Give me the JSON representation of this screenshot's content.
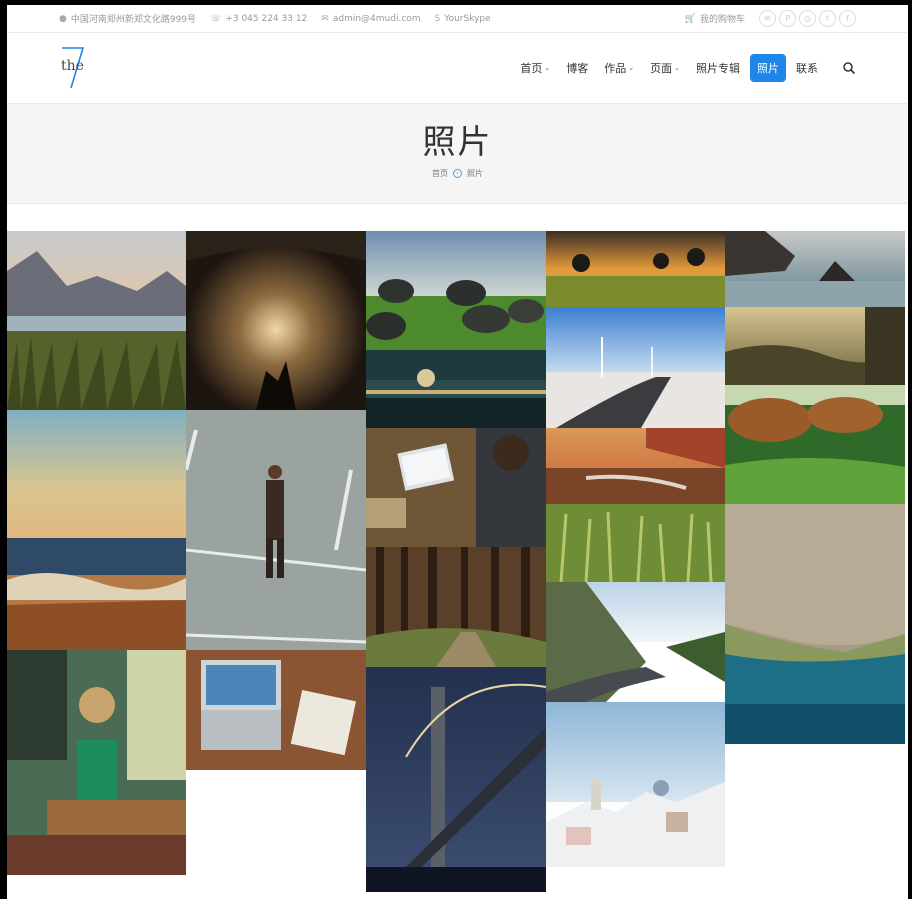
{
  "topbar": {
    "address": "中国河南郑州新郑文化路999号",
    "phone": "+3 045 224 33 12",
    "email": "admin@4mudi.com",
    "skype": "YourSkype",
    "cart": "我的购物车",
    "social_icons": [
      "mail-icon",
      "pinterest-icon",
      "dribbble-icon",
      "twitter-icon",
      "facebook-icon"
    ]
  },
  "logo": {
    "text": "the",
    "accent_color": "#1e86e8"
  },
  "nav": {
    "items": [
      {
        "label": "首页",
        "dropdown": true
      },
      {
        "label": "博客",
        "dropdown": false
      },
      {
        "label": "作品",
        "dropdown": true
      },
      {
        "label": "页面",
        "dropdown": true
      },
      {
        "label": "照片专辑",
        "dropdown": false
      },
      {
        "label": "照片",
        "dropdown": false,
        "active": true
      },
      {
        "label": "联系",
        "dropdown": false
      }
    ],
    "active_color": "#1e86e8"
  },
  "page": {
    "title": "照片",
    "breadcrumb": [
      "首页",
      "照片"
    ]
  },
  "gallery": {
    "photos": [
      "lake-mountains",
      "concert-stage",
      "rocks-field",
      "sunset-trees",
      "coast-rocks",
      "seaside-sunset",
      "man-walking-road",
      "city-night-river",
      "road-windmills",
      "misty-hills",
      "teddy-cafe",
      "laptop-desk",
      "laptop-notebook",
      "desert-road",
      "dogs-grass",
      "wheat-field",
      "forest-path",
      "mountain-road",
      "aerial-coast",
      "bridge-night",
      "santorini-village"
    ]
  }
}
